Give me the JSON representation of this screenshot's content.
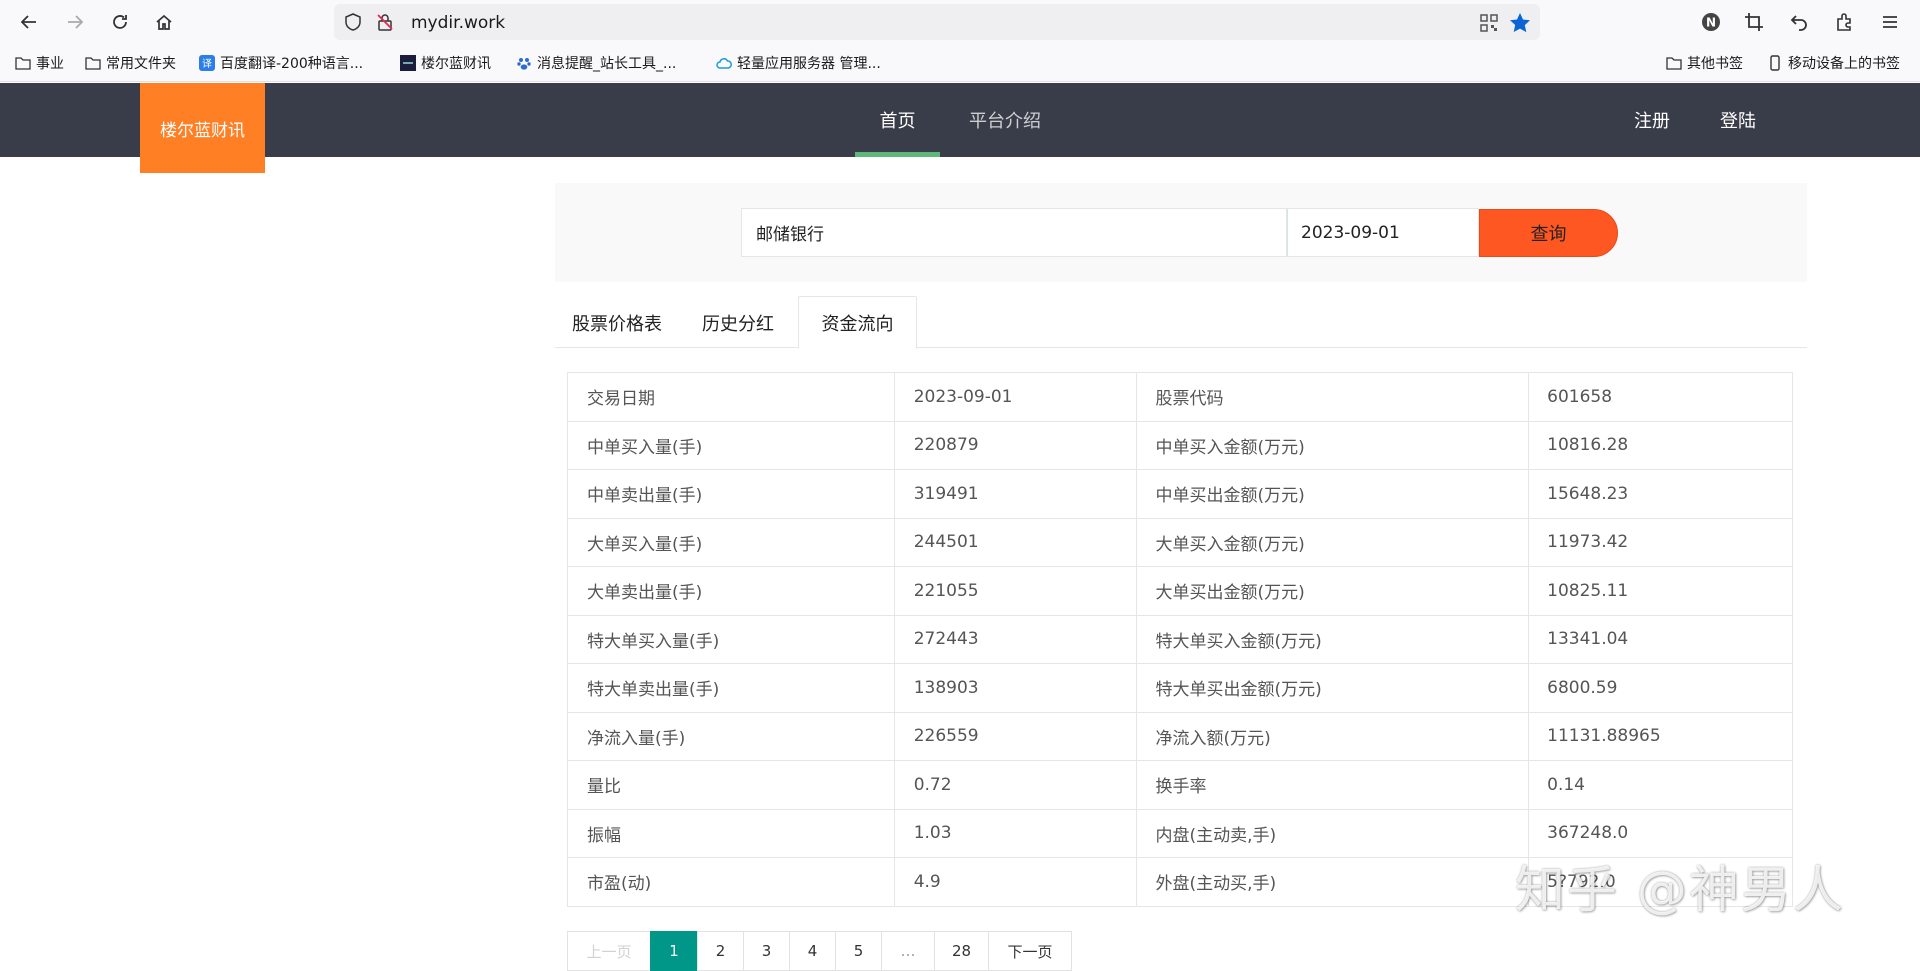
{
  "browser": {
    "url": "mydir.work",
    "bookmarks": [
      {
        "label": "事业"
      },
      {
        "label": "常用文件夹"
      },
      {
        "label": "百度翻译-200种语言..."
      },
      {
        "label": "楼尔蓝财讯"
      },
      {
        "label": "消息提醒_站长工具_..."
      },
      {
        "label": "轻量应用服务器 管理..."
      }
    ],
    "other_bookmarks": "其他书签",
    "mobile_bookmarks": "移动设备上的书签"
  },
  "header": {
    "logo": "楼尔蓝财讯",
    "nav": [
      {
        "label": "首页",
        "active": true
      },
      {
        "label": "平台介绍",
        "active": false
      }
    ],
    "register": "注册",
    "login": "登陆"
  },
  "search": {
    "stock_value": "邮储银行",
    "date_value": "2023-09-01",
    "button": "查询"
  },
  "tabs": [
    {
      "label": "股票价格表",
      "active": false
    },
    {
      "label": "历史分红",
      "active": false
    },
    {
      "label": "资金流向",
      "active": true
    }
  ],
  "table": {
    "rows": [
      [
        "交易日期",
        "2023-09-01",
        "股票代码",
        "601658"
      ],
      [
        "中单买入量(手)",
        "220879",
        "中单买入金额(万元)",
        "10816.28"
      ],
      [
        "中单卖出量(手)",
        "319491",
        "中单买出金额(万元)",
        "15648.23"
      ],
      [
        "大单买入量(手)",
        "244501",
        "大单买入金额(万元)",
        "11973.42"
      ],
      [
        "大单卖出量(手)",
        "221055",
        "大单买出金额(万元)",
        "10825.11"
      ],
      [
        "特大单买入量(手)",
        "272443",
        "特大单买入金额(万元)",
        "13341.04"
      ],
      [
        "特大单卖出量(手)",
        "138903",
        "特大单买出金额(万元)",
        "6800.59"
      ],
      [
        "净流入量(手)",
        "226559",
        "净流入额(万元)",
        "11131.88965"
      ],
      [
        "量比",
        "0.72",
        "换手率",
        "0.14"
      ],
      [
        "振幅",
        "1.03",
        "内盘(主动卖,手)",
        "367248.0"
      ],
      [
        "市盈(动)",
        "4.9",
        "外盘(主动买,手)",
        "5?792.0"
      ]
    ]
  },
  "pagination": {
    "prev": "上一页",
    "pages": [
      "1",
      "2",
      "3",
      "4",
      "5",
      "…",
      "28"
    ],
    "current": "1",
    "next": "下一页"
  },
  "watermark": "知乎 @神男人"
}
